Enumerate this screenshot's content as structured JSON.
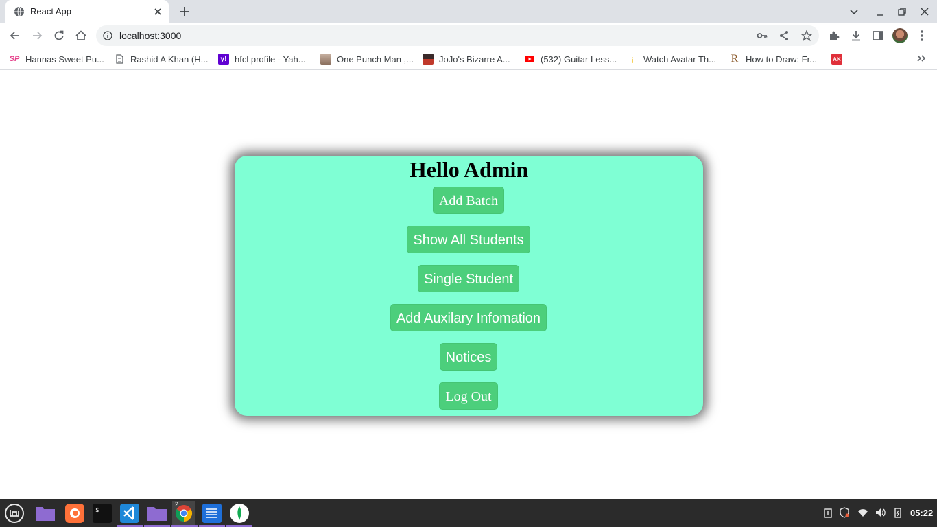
{
  "browser": {
    "tab": {
      "title": "React App"
    },
    "address": {
      "url": "localhost:3000"
    },
    "bookmarks": [
      {
        "label": "Hannas Sweet Pu...",
        "icon": "sp-icon",
        "color": "#e5408a"
      },
      {
        "label": "Rashid A Khan (H...",
        "icon": "document-icon",
        "color": "#5f6368"
      },
      {
        "label": "hfcl profile - Yah...",
        "icon": "yahoo-icon",
        "color": "#6001d2"
      },
      {
        "label": "One Punch Man ,...",
        "icon": "person-icon",
        "color": "#a08070"
      },
      {
        "label": "JoJo's Bizarre A...",
        "icon": "jojo-icon",
        "color": "#c0392b"
      },
      {
        "label": "(532) Guitar Less...",
        "icon": "youtube-icon",
        "color": "#ff0000"
      },
      {
        "label": "Watch Avatar Th...",
        "icon": "avatar-site-icon",
        "color": "#f4c430"
      },
      {
        "label": "How to Draw: Fr...",
        "icon": "r-icon",
        "color": "#8b5a2b"
      },
      {
        "label": "",
        "icon": "ak-icon",
        "color": "#e0303a"
      }
    ]
  },
  "card": {
    "title": "Hello Admin",
    "buttons": [
      {
        "label": "Add Batch"
      },
      {
        "label": "Show All Students"
      },
      {
        "label": "Single Student"
      },
      {
        "label": "Add Auxilary Infomation"
      },
      {
        "label": "Notices"
      },
      {
        "label": "Log Out"
      }
    ],
    "colors": {
      "card_bg": "#7fffd4",
      "button_bg": "#4ccf7c",
      "button_text": "#ffffff"
    }
  },
  "taskbar": {
    "apps": [
      "mint-menu-icon",
      "folder-icon",
      "firefox-icon",
      "terminal-icon",
      "vscode-icon",
      "files-icon",
      "chrome-icon",
      "text-editor-icon",
      "mongodb-compass-icon"
    ],
    "chrome_badge": "2",
    "clock": "05:22"
  }
}
